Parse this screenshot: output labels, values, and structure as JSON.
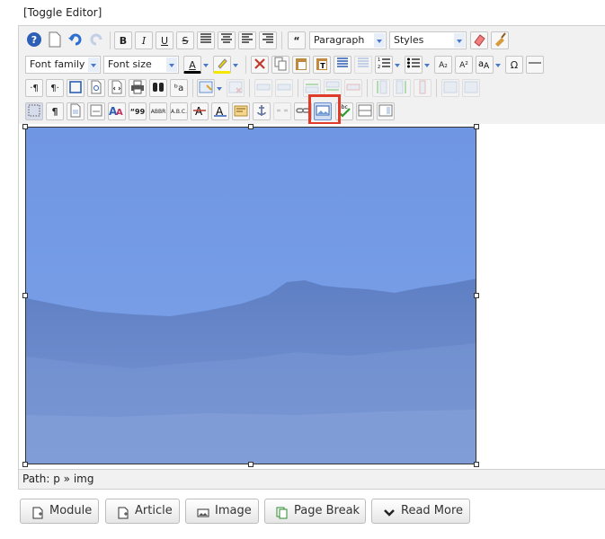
{
  "toggle_editor": "[Toggle Editor]",
  "toolbar": {
    "format_select": "Paragraph",
    "styles_select": "Styles",
    "font_family_select": "Font family",
    "font_size_select": "Font size",
    "bold": "B",
    "italic": "I",
    "underline": "U",
    "strike": "S",
    "blockquote": "“",
    "subscript": "A₂",
    "superscript": "A²",
    "charmap": "Ω",
    "color_a": "A",
    "attribs": "ᵇa",
    "abbr": "ABBR",
    "acronym": "A.B.C.",
    "quote": "“99",
    "para": "¶"
  },
  "status": {
    "path_label": "Path:",
    "path_value": "p » img"
  },
  "buttons": [
    {
      "label": "Module"
    },
    {
      "label": "Article"
    },
    {
      "label": "Image"
    },
    {
      "label": "Page Break"
    },
    {
      "label": "Read More"
    }
  ]
}
